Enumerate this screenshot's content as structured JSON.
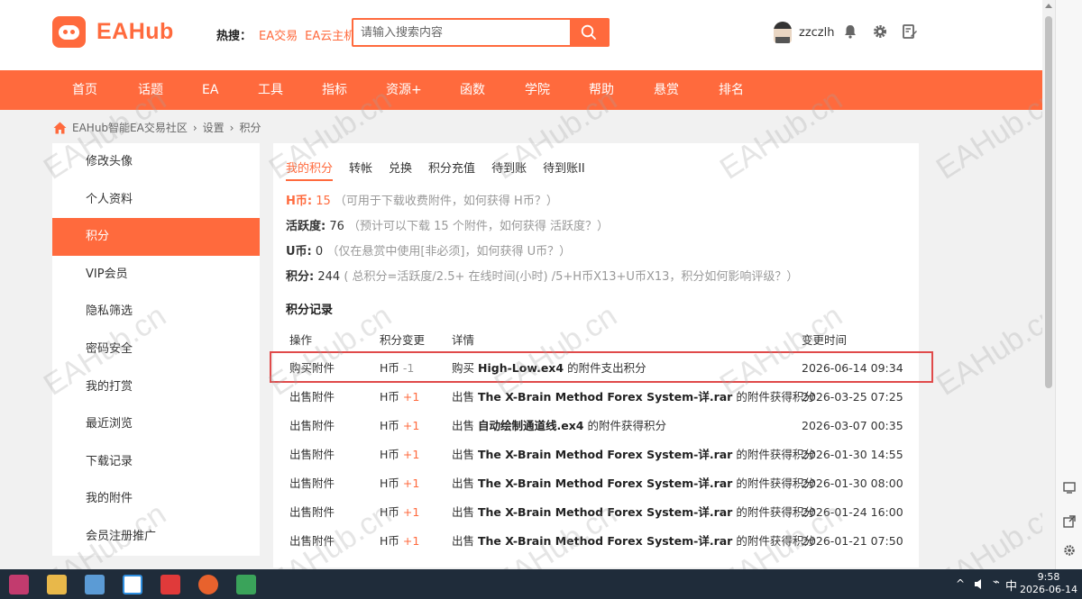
{
  "header": {
    "logo_text": "EAHub",
    "hot_label": "热搜：",
    "hot_links": [
      "EA交易",
      "EA云主机"
    ],
    "search_placeholder": "请输入搜索内容",
    "username": "zzczlh"
  },
  "nav": [
    "首页",
    "话题",
    "EA",
    "工具",
    "指标",
    "资源+",
    "函数",
    "学院",
    "帮助",
    "悬赏",
    "排名"
  ],
  "breadcrumb": [
    "EAHub智能EA交易社区",
    "设置",
    "积分"
  ],
  "sidebar": {
    "items": [
      "修改头像",
      "个人资料",
      "积分",
      "VIP会员",
      "隐私筛选",
      "密码安全",
      "我的打赏",
      "最近浏览",
      "下载记录",
      "我的附件",
      "会员注册推广"
    ],
    "active_index": 2
  },
  "tabs": [
    "我的积分",
    "转帐",
    "兑换",
    "积分充值",
    "待到账",
    "待到账II"
  ],
  "credits": {
    "h_label": "H币:",
    "h_value": "15",
    "h_note": "（可用于下载收费附件，如何获得 H币？）",
    "act_label": "活跃度:",
    "act_value": "76",
    "act_note": "（预计可以下载 15 个附件，如何获得 活跃度？）",
    "u_label": "U币:",
    "u_value": "0",
    "u_note": "（仅在悬赏中使用[非必须]，如何获得 U币？）",
    "total_label": "积分:",
    "total_value": "244",
    "total_note": "( 总积分=活跃度/2.5+ 在线时间(小时) /5+H币X13+U币X13，积分如何影响评级？）"
  },
  "records": {
    "title": "积分记录",
    "headers": [
      "操作",
      "积分变更",
      "详情",
      "变更时间"
    ],
    "rows": [
      {
        "op": "购买附件",
        "unit": "H币",
        "delta": "-1",
        "pre": "购买",
        "file": "High-Low.ex4",
        "post": "的附件支出积分",
        "time": "2026-06-14 09:34"
      },
      {
        "op": "出售附件",
        "unit": "H币",
        "delta": "+1",
        "pre": "出售",
        "file": "The X-Brain Method Forex System-详.rar",
        "post": "的附件获得积分",
        "time": "2026-03-25 07:25"
      },
      {
        "op": "出售附件",
        "unit": "H币",
        "delta": "+1",
        "pre": "出售",
        "file": "自动绘制通道线.ex4",
        "post": "的附件获得积分",
        "time": "2026-03-07 00:35"
      },
      {
        "op": "出售附件",
        "unit": "H币",
        "delta": "+1",
        "pre": "出售",
        "file": "The X-Brain Method Forex System-详.rar",
        "post": "的附件获得积分",
        "time": "2026-01-30 14:55"
      },
      {
        "op": "出售附件",
        "unit": "H币",
        "delta": "+1",
        "pre": "出售",
        "file": "The X-Brain Method Forex System-详.rar",
        "post": "的附件获得积分",
        "time": "2026-01-30 08:00"
      },
      {
        "op": "出售附件",
        "unit": "H币",
        "delta": "+1",
        "pre": "出售",
        "file": "The X-Brain Method Forex System-详.rar",
        "post": "的附件获得积分",
        "time": "2026-01-24 16:00"
      },
      {
        "op": "出售附件",
        "unit": "H币",
        "delta": "+1",
        "pre": "出售",
        "file": "The X-Brain Method Forex System-详.rar",
        "post": "的附件获得积分",
        "time": "2026-01-21 07:50"
      }
    ]
  },
  "watermark": "EAHub.cn",
  "taskbar": {
    "ime": "中",
    "time": "9:58",
    "date": "2026-06-14"
  },
  "colors": {
    "brand": "#ff6a3d",
    "highlight_border": "#e04a4a",
    "taskbar": "#1f2c3a"
  }
}
